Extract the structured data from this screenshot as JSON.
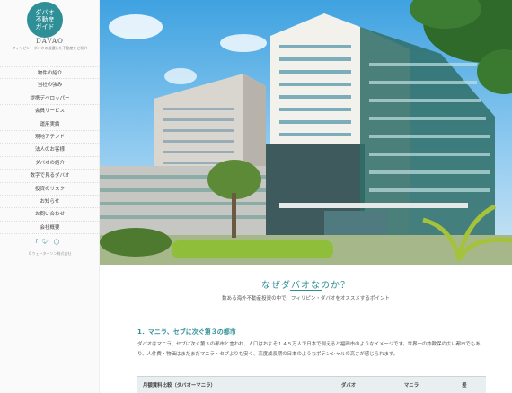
{
  "logo": {
    "jp_line1": "ダバオ",
    "jp_line2": "不動産",
    "jp_line3": "ガイド",
    "en": "DAVAO",
    "tagline": "フィリピン・ダバオの厳選した不動産をご紹介"
  },
  "nav": [
    "物件の紹介",
    "当社の強み",
    "提携デベロッパー",
    "会員サービス",
    "運用実績",
    "現地アテンド",
    "法人のお客様",
    "ダバオの紹介",
    "数字で見るダバオ",
    "投資のリスク",
    "お知らせ",
    "お問い合わせ",
    "会社概要"
  ],
  "social_icons": [
    "facebook-icon",
    "twitter-icon",
    "instagram-icon"
  ],
  "copyright": "©ウェーターソン株式会社",
  "main": {
    "title": "なぜダバオなのか？",
    "lead": "数ある海外不動産投資の中で、フィリピン・ダバオをオススメするポイント",
    "section_title": "1．マニラ、セブに次ぐ第３の都市",
    "paragraph": "ダバオはマニラ、セブに次ぐ第３の都市と言われ、人口はおよそ１４５万人で日本で例えると福岡市のようなイメージです。世界一の詐欺保の広い都市でもあり、人件費・物価はまだまだマニラ・セブよりも安く、高度成長期の日本のようなポテンシャルの高さが感じられます。",
    "table_header": [
      "月額賃料比較（ダバオーマニラ）",
      "ダバオ",
      "マニラ",
      "差"
    ]
  }
}
